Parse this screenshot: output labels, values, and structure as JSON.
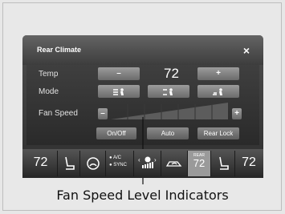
{
  "window": {
    "title": "Rear Climate",
    "close_label": "×"
  },
  "rows": {
    "temp_label": "Temp",
    "mode_label": "Mode",
    "fan_label": "Fan Speed"
  },
  "temp": {
    "minus_label": "–",
    "value": "72",
    "plus_label": "+"
  },
  "mode": {
    "buttons": [
      "mode-face-icon",
      "mode-bilevel-icon",
      "mode-foot-icon"
    ]
  },
  "fan": {
    "minus_label": "–",
    "plus_label": "+",
    "level_indicators": 7
  },
  "buttons": {
    "onoff": "On/Off",
    "auto": "Auto",
    "rear_lock": "Rear Lock"
  },
  "bottom_bar": {
    "driver_temp": "72",
    "ac_label": "A/C",
    "sync_label": "SYNC",
    "rear_label": "REAR",
    "rear_temp": "72",
    "passenger_temp": "72"
  },
  "caption": "Fan Speed Level Indicators",
  "colors": {
    "accent": "#ffffff",
    "screen_bg": "#2d2d2d",
    "button": "#8a8a8a"
  }
}
